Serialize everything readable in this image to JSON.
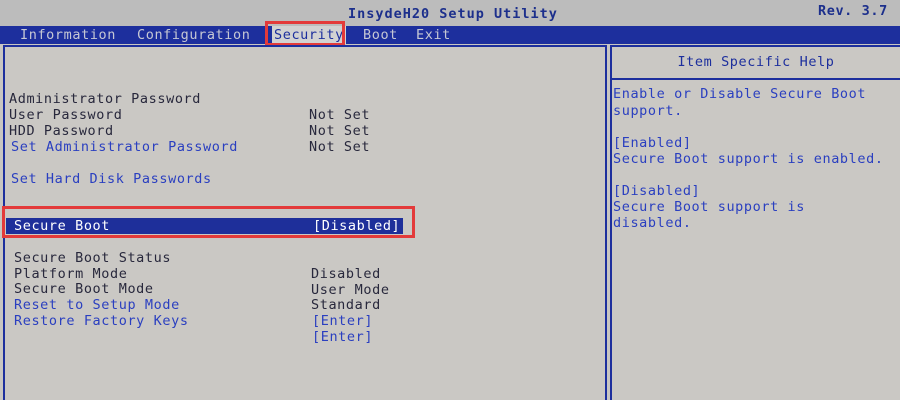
{
  "header": {
    "title": "InsydeH20 Setup Utility",
    "version": "Rev. 3.7"
  },
  "menu": {
    "tabs": [
      {
        "label": "Information"
      },
      {
        "label": "Configuration"
      },
      {
        "label": "Security",
        "active": true
      },
      {
        "label": "Boot"
      },
      {
        "label": "Exit"
      }
    ]
  },
  "passwords": [
    {
      "label": "Administrator Password",
      "value": "Not Set"
    },
    {
      "label": "User Password",
      "value": "Not Set"
    },
    {
      "label": "HDD Password",
      "value": "Not Set"
    }
  ],
  "actions": {
    "set_admin_password": "Set Administrator Password",
    "set_hdd_passwords": "Set Hard Disk Passwords"
  },
  "secure_boot": {
    "secure_boot": {
      "label": "Secure Boot",
      "value": "[Disabled]",
      "selected": true
    },
    "status": {
      "label": "Secure Boot Status",
      "value": "Disabled"
    },
    "platform_mode": {
      "label": "Platform Mode",
      "value": "User Mode"
    },
    "boot_mode": {
      "label": "Secure Boot Mode",
      "value": "Standard"
    },
    "reset_setup": {
      "label": "Reset to Setup Mode",
      "value": "[Enter]"
    },
    "restore_keys": {
      "label": "Restore Factory Keys",
      "value": "[Enter]"
    }
  },
  "help": {
    "title": "Item Specific Help",
    "lines": [
      "Enable or Disable Secure Boot",
      "support.",
      "[Enabled]",
      "Secure Boot support is enabled.",
      "[Disabled]",
      "Secure Boot support is",
      "disabled."
    ]
  },
  "colors": {
    "menu_bar": "#1d2f9d",
    "panel_background": "#cac8c4",
    "option_text": "#2a3fc0",
    "highlight_outline": "#e33a3a"
  }
}
